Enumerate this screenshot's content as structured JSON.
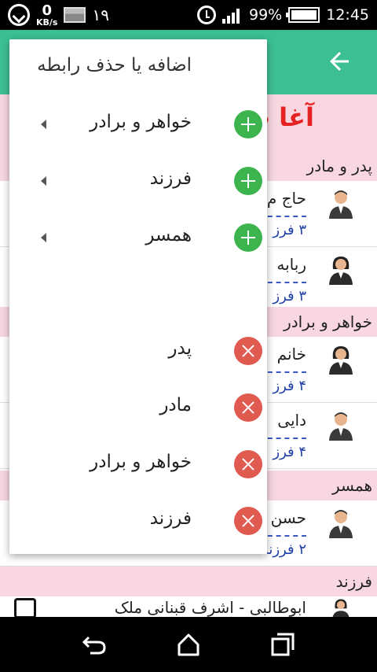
{
  "status_bar": {
    "net_speed": "0",
    "net_unit": "KB/s",
    "notification_count": "۱۹",
    "battery_percent": "99%",
    "time": "12:45",
    "icons": [
      "sync-icon",
      "image-icon",
      "alarm-icon",
      "signal-icon",
      "battery-icon"
    ]
  },
  "app_bar": {
    "back_icon": "arrow-left-icon",
    "color": "#3cbf91"
  },
  "background": {
    "title": "آغا ب",
    "sections": {
      "parents": "پدر و مادر",
      "siblings": "خواهر و برادر",
      "spouse": "همسر",
      "children": "فرزند"
    },
    "people": [
      {
        "name": "حاج م",
        "count": "۳ فرز",
        "gender": "male"
      },
      {
        "name": "ربابه",
        "count": "۳ فرز",
        "gender": "female"
      },
      {
        "name": "خانم",
        "count": "۴ فرز",
        "gender": "female"
      },
      {
        "name": "دایی",
        "count": "۴ فرز",
        "gender": "male"
      },
      {
        "name": "حسن",
        "count": "۲ فرزند",
        "gender": "male"
      }
    ],
    "last_row_name": "ابوطالبی - اشرف قبنانی ملک",
    "header_color": "#f8d7e0",
    "title_color": "#e52222"
  },
  "popup": {
    "title": "اضافه یا حذف رابطه",
    "add_items": [
      {
        "label": "خواهر و برادر",
        "icon": "add-circle-icon"
      },
      {
        "label": "فرزند",
        "icon": "add-circle-icon"
      },
      {
        "label": "همسر",
        "icon": "add-circle-icon"
      }
    ],
    "remove_items": [
      {
        "label": "پدر",
        "icon": "remove-circle-icon"
      },
      {
        "label": "مادر",
        "icon": "remove-circle-icon"
      },
      {
        "label": "خواهر و برادر",
        "icon": "remove-circle-icon"
      },
      {
        "label": "فرزند",
        "icon": "remove-circle-icon"
      }
    ],
    "add_color": "#3db54e",
    "remove_color": "#e05a50"
  },
  "nav_bar": {
    "icons": [
      "back-nav-icon",
      "home-nav-icon",
      "recents-nav-icon"
    ]
  }
}
